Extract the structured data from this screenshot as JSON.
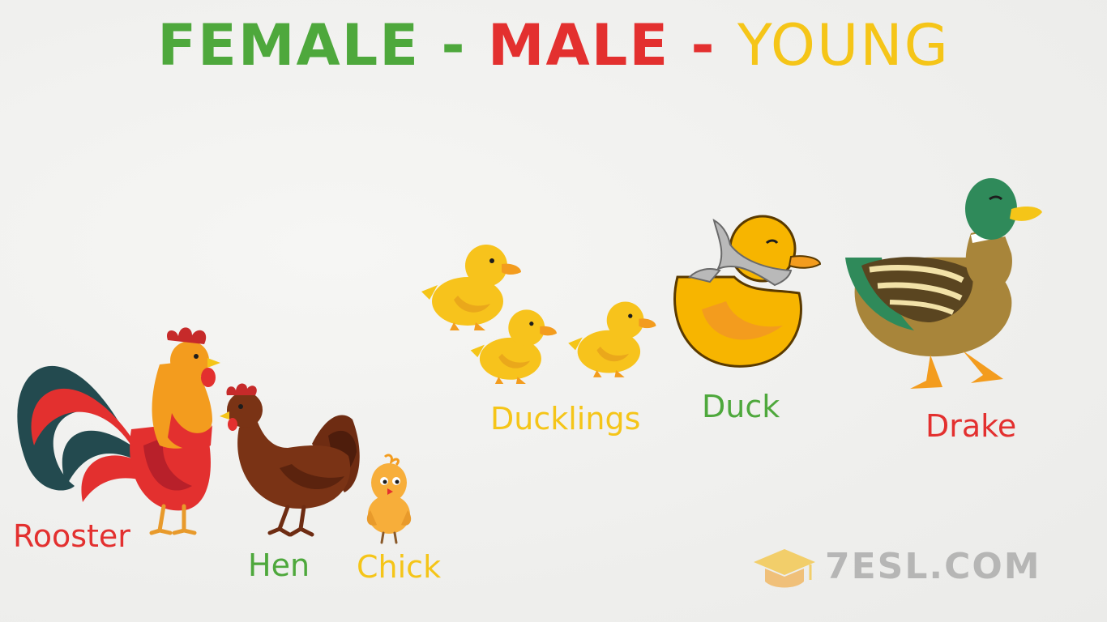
{
  "title": {
    "female": "FEMALE",
    "sep1": " - ",
    "male": "MALE",
    "sep2": " - ",
    "young": "YOUNG"
  },
  "labels": {
    "rooster": "Rooster",
    "hen": "Hen",
    "chick": "Chick",
    "ducklings": "Ducklings",
    "duck": "Duck",
    "drake": "Drake"
  },
  "logo": {
    "text": "7ESL.COM"
  },
  "colors": {
    "female": "#4ea83c",
    "male": "#e3302f",
    "young": "#f5c518"
  },
  "icons": {
    "rooster": "rooster-icon",
    "hen": "hen-icon",
    "chick": "chick-icon",
    "ducklings": "duckling-icon",
    "duck": "duck-icon",
    "drake": "drake-icon",
    "logo": "graduation-cap-icon"
  }
}
